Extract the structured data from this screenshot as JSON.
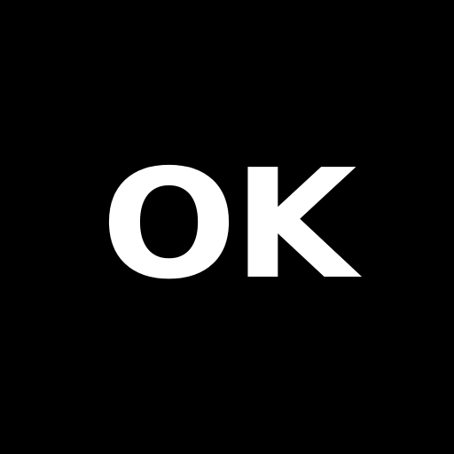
{
  "text": "OK",
  "colors": {
    "background": "#000000",
    "text": "#ffffff"
  }
}
